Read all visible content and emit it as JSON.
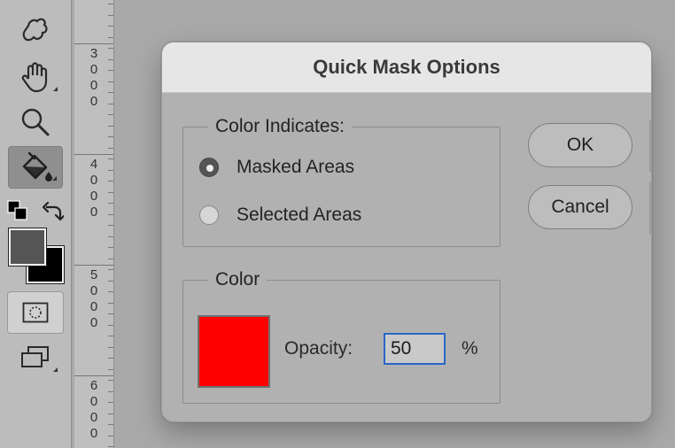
{
  "toolbar": {
    "tools": [
      {
        "name": "puppet-warp-icon"
      },
      {
        "name": "hand-icon"
      },
      {
        "name": "zoom-icon"
      },
      {
        "name": "paint-bucket-icon",
        "selected": true
      }
    ],
    "foreground_color": "#555555",
    "background_color": "#000000",
    "extra_tools": [
      "quick-mask-icon",
      "screen-mode-icon"
    ]
  },
  "ruler": {
    "labels": [
      "3\n0\n0\n0",
      "4\n0\n0\n0",
      "5\n0\n0\n0",
      "6\n0\n0\n0"
    ]
  },
  "dialog": {
    "title": "Quick Mask Options",
    "color_indicates": {
      "legend": "Color Indicates:",
      "options": [
        {
          "label": "Masked Areas",
          "checked": true
        },
        {
          "label": "Selected Areas",
          "checked": false
        }
      ]
    },
    "color": {
      "legend": "Color",
      "swatch": "#ff0000",
      "opacity_label": "Opacity:",
      "opacity_value": "50",
      "opacity_unit": "%"
    },
    "buttons": {
      "ok": "OK",
      "cancel": "Cancel"
    }
  }
}
